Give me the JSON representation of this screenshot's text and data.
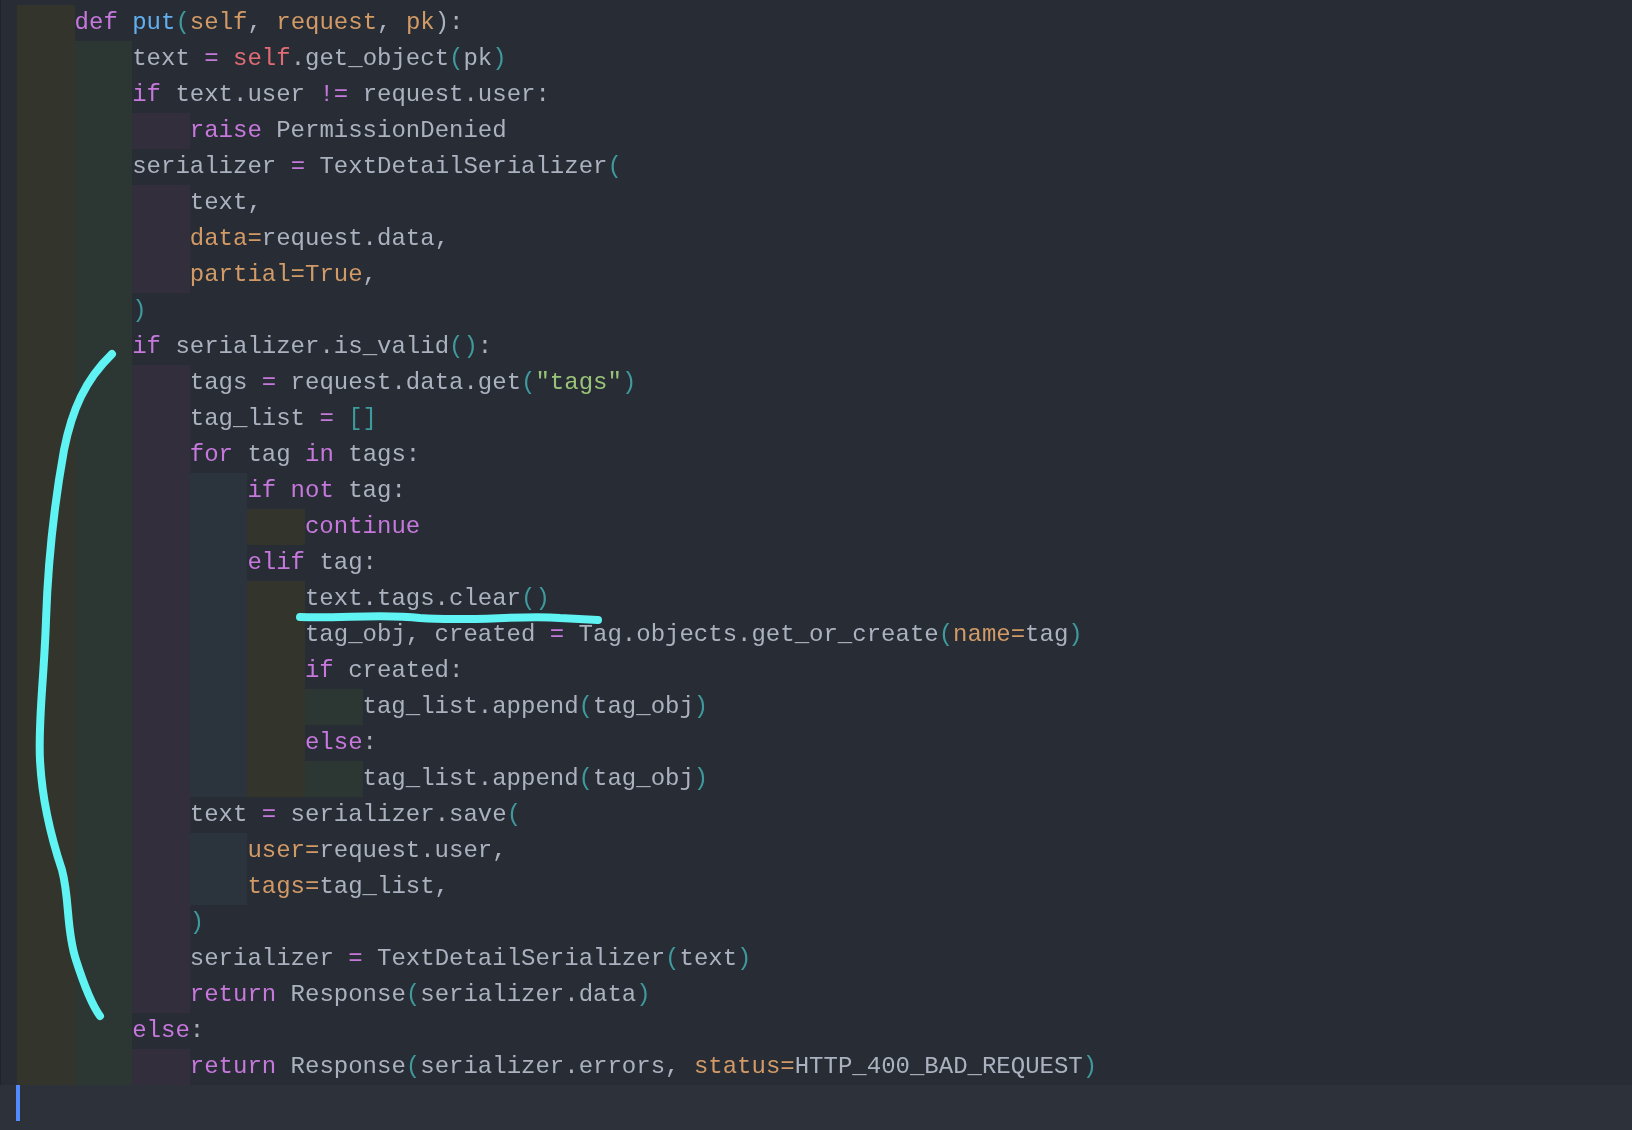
{
  "editor": {
    "lines": [
      {
        "tokens": [
          {
            "text": "def",
            "kind": "kw"
          },
          {
            "text": " put",
            "kind": "fn"
          },
          {
            "text": "(",
            "kind": "punc"
          },
          {
            "text": "self",
            "kind": "param"
          },
          {
            "text": ", ",
            "kind": "plain"
          },
          {
            "text": "request",
            "kind": "param"
          },
          {
            "text": ", ",
            "kind": "plain"
          },
          {
            "text": "pk",
            "kind": "param"
          },
          {
            "text": "):",
            "kind": "plain"
          }
        ],
        "children": [
          {
            "tokens": [
              {
                "text": "text ",
                "kind": "plain"
              },
              {
                "text": "=",
                "kind": "op"
              },
              {
                "text": " self",
                "kind": "self"
              },
              {
                "text": ".get_object",
                "kind": "plain"
              },
              {
                "text": "(",
                "kind": "punc"
              },
              {
                "text": "pk",
                "kind": "plain"
              },
              {
                "text": ")",
                "kind": "punc"
              }
            ]
          },
          {
            "tokens": [
              {
                "text": "if",
                "kind": "kw"
              },
              {
                "text": " text.user ",
                "kind": "plain"
              },
              {
                "text": "!=",
                "kind": "op"
              },
              {
                "text": " request.user:",
                "kind": "plain"
              }
            ],
            "children": [
              {
                "tokens": [
                  {
                    "text": "raise",
                    "kind": "kw"
                  },
                  {
                    "text": " PermissionDenied",
                    "kind": "plain"
                  }
                ]
              }
            ]
          },
          {
            "tokens": [
              {
                "text": "serializer ",
                "kind": "plain"
              },
              {
                "text": "=",
                "kind": "op"
              },
              {
                "text": " TextDetailSerializer",
                "kind": "plain"
              },
              {
                "text": "(",
                "kind": "punc"
              }
            ],
            "children": [
              {
                "tokens": [
                  {
                    "text": "text,",
                    "kind": "plain"
                  }
                ]
              },
              {
                "tokens": [
                  {
                    "text": "data=",
                    "kind": "param"
                  },
                  {
                    "text": "request.data,",
                    "kind": "plain"
                  }
                ]
              },
              {
                "tokens": [
                  {
                    "text": "partial=True",
                    "kind": "param"
                  },
                  {
                    "text": ",",
                    "kind": "plain"
                  }
                ]
              }
            ]
          },
          {
            "tokens": [
              {
                "text": ")",
                "kind": "punc"
              }
            ]
          },
          {
            "tokens": [
              {
                "text": "if",
                "kind": "kw"
              },
              {
                "text": " serializer.is_valid",
                "kind": "plain"
              },
              {
                "text": "()",
                "kind": "punc"
              },
              {
                "text": ":",
                "kind": "plain"
              }
            ],
            "children": [
              {
                "tokens": [
                  {
                    "text": "tags ",
                    "kind": "plain"
                  },
                  {
                    "text": "=",
                    "kind": "op"
                  },
                  {
                    "text": " request.data.get",
                    "kind": "plain"
                  },
                  {
                    "text": "(",
                    "kind": "punc"
                  },
                  {
                    "text": "\"tags\"",
                    "kind": "str"
                  },
                  {
                    "text": ")",
                    "kind": "punc"
                  }
                ]
              },
              {
                "tokens": [
                  {
                    "text": "tag_list ",
                    "kind": "plain"
                  },
                  {
                    "text": "=",
                    "kind": "op"
                  },
                  {
                    "text": " []",
                    "kind": "punc"
                  }
                ]
              },
              {
                "tokens": [
                  {
                    "text": "for",
                    "kind": "kw"
                  },
                  {
                    "text": " tag ",
                    "kind": "plain"
                  },
                  {
                    "text": "in",
                    "kind": "kw"
                  },
                  {
                    "text": " tags:",
                    "kind": "plain"
                  }
                ],
                "children": [
                  {
                    "tokens": [
                      {
                        "text": "if not",
                        "kind": "kw"
                      },
                      {
                        "text": " tag:",
                        "kind": "plain"
                      }
                    ],
                    "children": [
                      {
                        "tokens": [
                          {
                            "text": "continue",
                            "kind": "kw"
                          }
                        ]
                      }
                    ]
                  },
                  {
                    "tokens": [
                      {
                        "text": "elif",
                        "kind": "kw"
                      },
                      {
                        "text": " tag:",
                        "kind": "plain"
                      }
                    ],
                    "children": [
                      {
                        "tokens": [
                          {
                            "text": "text.tags.clear",
                            "kind": "plain"
                          },
                          {
                            "text": "()",
                            "kind": "punc"
                          }
                        ]
                      },
                      {
                        "tokens": [
                          {
                            "text": "tag_obj, created ",
                            "kind": "plain"
                          },
                          {
                            "text": "=",
                            "kind": "op"
                          },
                          {
                            "text": " Tag.objects.get_or_create",
                            "kind": "plain"
                          },
                          {
                            "text": "(",
                            "kind": "punc"
                          },
                          {
                            "text": "name=",
                            "kind": "param"
                          },
                          {
                            "text": "tag",
                            "kind": "plain"
                          },
                          {
                            "text": ")",
                            "kind": "punc"
                          }
                        ]
                      },
                      {
                        "tokens": [
                          {
                            "text": "if",
                            "kind": "kw"
                          },
                          {
                            "text": " created:",
                            "kind": "plain"
                          }
                        ],
                        "children": [
                          {
                            "tokens": [
                              {
                                "text": "tag_list.append",
                                "kind": "plain"
                              },
                              {
                                "text": "(",
                                "kind": "punc"
                              },
                              {
                                "text": "tag_obj",
                                "kind": "plain"
                              },
                              {
                                "text": ")",
                                "kind": "punc"
                              }
                            ]
                          }
                        ]
                      },
                      {
                        "tokens": [
                          {
                            "text": "else",
                            "kind": "kw"
                          },
                          {
                            "text": ":",
                            "kind": "plain"
                          }
                        ],
                        "children": [
                          {
                            "tokens": [
                              {
                                "text": "tag_list.append",
                                "kind": "plain"
                              },
                              {
                                "text": "(",
                                "kind": "punc"
                              },
                              {
                                "text": "tag_obj",
                                "kind": "plain"
                              },
                              {
                                "text": ")",
                                "kind": "punc"
                              }
                            ]
                          }
                        ]
                      }
                    ]
                  }
                ]
              },
              {
                "tokens": [
                  {
                    "text": "text ",
                    "kind": "plain"
                  },
                  {
                    "text": "=",
                    "kind": "op"
                  },
                  {
                    "text": " serializer.save",
                    "kind": "plain"
                  },
                  {
                    "text": "(",
                    "kind": "punc"
                  }
                ],
                "children": [
                  {
                    "tokens": [
                      {
                        "text": "user=",
                        "kind": "param"
                      },
                      {
                        "text": "request.user,",
                        "kind": "plain"
                      }
                    ]
                  },
                  {
                    "tokens": [
                      {
                        "text": "tags=",
                        "kind": "param"
                      },
                      {
                        "text": "tag_list,",
                        "kind": "plain"
                      }
                    ]
                  }
                ]
              },
              {
                "tokens": [
                  {
                    "text": ")",
                    "kind": "punc"
                  }
                ]
              },
              {
                "tokens": [
                  {
                    "text": "serializer ",
                    "kind": "plain"
                  },
                  {
                    "text": "=",
                    "kind": "op"
                  },
                  {
                    "text": " TextDetailSerializer",
                    "kind": "plain"
                  },
                  {
                    "text": "(",
                    "kind": "punc"
                  },
                  {
                    "text": "text",
                    "kind": "plain"
                  },
                  {
                    "text": ")",
                    "kind": "punc"
                  }
                ]
              },
              {
                "tokens": [
                  {
                    "text": "return",
                    "kind": "kw"
                  },
                  {
                    "text": " Response",
                    "kind": "plain"
                  },
                  {
                    "text": "(",
                    "kind": "punc"
                  },
                  {
                    "text": "serializer.data",
                    "kind": "plain"
                  },
                  {
                    "text": ")",
                    "kind": "punc"
                  }
                ]
              }
            ]
          },
          {
            "tokens": [
              {
                "text": "else",
                "kind": "kw"
              },
              {
                "text": ":",
                "kind": "plain"
              }
            ],
            "children": [
              {
                "tokens": [
                  {
                    "text": "return",
                    "kind": "kw"
                  },
                  {
                    "text": " Response",
                    "kind": "plain"
                  },
                  {
                    "text": "(",
                    "kind": "punc"
                  },
                  {
                    "text": "serializer.errors, ",
                    "kind": "plain"
                  },
                  {
                    "text": "status=",
                    "kind": "param"
                  },
                  {
                    "text": "HTTP_400_BAD_REQUEST",
                    "kind": "plain"
                  },
                  {
                    "text": ")",
                    "kind": "punc"
                  }
                ]
              }
            ]
          }
        ]
      }
    ]
  }
}
